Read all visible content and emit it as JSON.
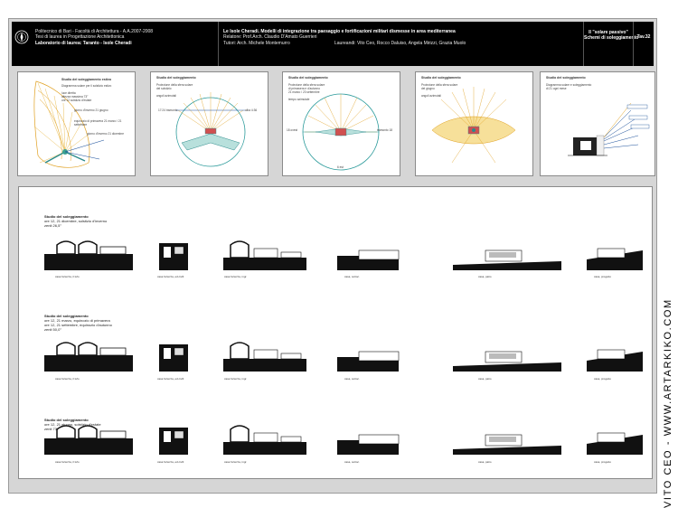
{
  "header": {
    "left": [
      "Politecnico di Bari - Facoltà di Architettura - A.A.2007-2008",
      "Tesi di laurea in Progettazione Architettonica",
      "Laboratorio di laurea:  Taranto - Isole Cheradi"
    ],
    "center_title": "Le Isole Cheradi.  Modelli di integrazione tra paesaggio e fortificazioni militari dismesse in area mediterranea",
    "center_lines": [
      "Relatore: Prof.Arch. Claudio D'Amato Guerrieri",
      "Tutori: Arch. Michele Montemurro"
    ],
    "students": "Laureandi: Vito Ceo, Rocco Daluiso, Angela Mirizzi, Grazia Muolo",
    "right_title": "Il \"solare passivo\"",
    "right_subtitle": "Schemi di soleggiamento",
    "table_code": "Tav.32"
  },
  "panels": [
    {
      "title": "Studio del soleggiamento estivo",
      "notes": [
        "Diagramma solare per il solstizio estivo",
        "luce diretta",
        "altezza massima 73°",
        "ore 12 solstizio d'estate"
      ],
      "labels": [
        "giorno d'inverno 21 giugno",
        "equinozio di primavera 21 marzo / 21 settembre",
        "giorno d'inverno 21 dicembre"
      ]
    },
    {
      "title": "Studio del soleggiamento",
      "notes": [
        "Proiezione della sfera solare",
        "del solstizio",
        "angoli azimutali"
      ],
      "labels": [
        "17:24 tramonto",
        "alba 4:36"
      ]
    },
    {
      "title": "Studio del soleggiamento",
      "notes": [
        "Proiezione della sfera solare",
        "di primavera e d'autunno",
        "21 marzo / 23 settembre",
        "tempo azimutale"
      ],
      "labels": [
        "18 ovest",
        "tramonto 18",
        "6 est"
      ]
    },
    {
      "title": "Studio del soleggiamento",
      "notes": [
        "Proiezione della sfera solare",
        "del giugno",
        "angoli azimutali"
      ],
      "labels": []
    },
    {
      "title": "Studio del soleggiamento",
      "notes": [
        "Diagramma solare e soleggiamento",
        "di 21 ogni mese"
      ],
      "labels": []
    }
  ],
  "rows": [
    {
      "title": "Studio del soleggiamento",
      "lines": [
        "ore 12, 21 dicembre, solstizio d'inverno",
        "zenit 26,5°"
      ],
      "captions": [
        "casa fortezza, il tufo",
        "casa fortezza, ed.civili",
        "casa fortezza, ingr.",
        "casa, sottoc.",
        "casa, patio",
        "casa, progetto"
      ]
    },
    {
      "title": "Studio del soleggiamento",
      "lines": [
        "ore 12, 21 marzo, equinozio di primavera",
        "ore 12, 21 settembre, equinozio d'autunno",
        "zenit 50,0°"
      ],
      "captions": [
        "casa fortezza, il tufo",
        "casa fortezza, ed.civili",
        "casa fortezza, ingr.",
        "casa, sottoc.",
        "casa, patio",
        "casa, progetto"
      ]
    },
    {
      "title": "Studio del soleggiamento",
      "lines": [
        "ore 12, 21 giugno, solstizio d'estate",
        "zenit 73,5°"
      ],
      "captions": [
        "casa fortezza, il tufo",
        "casa fortezza, ed.civili",
        "casa fortezza, ingr.",
        "casa, sottoc.",
        "casa, patio",
        "casa, progetto"
      ]
    }
  ],
  "side_text": "VITO CEO - WWW.ARTARKIKO.COM"
}
